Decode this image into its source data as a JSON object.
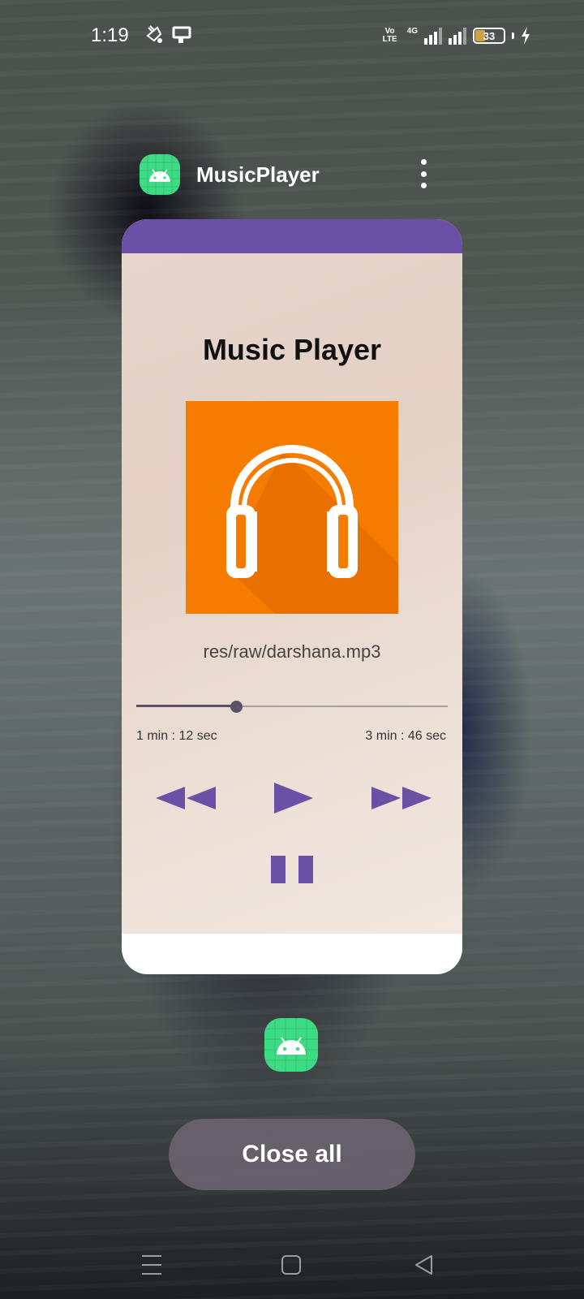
{
  "status_bar": {
    "time": "1:19",
    "network_label": "4G",
    "volte_line1": "Vo LTE",
    "volte_line2": "LTE2",
    "battery_level": "33",
    "battery_color": "#c9a53c"
  },
  "recents": {
    "app_name": "MusicPlayer",
    "app_icon": "android-icon",
    "menu_icon": "more-vert-icon"
  },
  "player": {
    "topbar_color": "#6b51a6",
    "title": "Music Player",
    "album_art_icon": "headphones-icon",
    "album_color": "#f57c00",
    "file": "res/raw/darshana.mp3",
    "progress_fraction": 0.32,
    "current_time": "1 min : 12 sec",
    "total_time": "3 min : 46 sec",
    "controls": {
      "rewind_icon": "rewind-icon",
      "play_icon": "play-icon",
      "forward_icon": "fast-forward-icon",
      "pause_icon": "pause-icon",
      "control_color": "#6b51a6"
    }
  },
  "close_all_label": "Close all",
  "nav": {
    "recents_icon": "menu-lines-icon",
    "home_icon": "home-square-icon",
    "back_icon": "back-triangle-icon"
  }
}
